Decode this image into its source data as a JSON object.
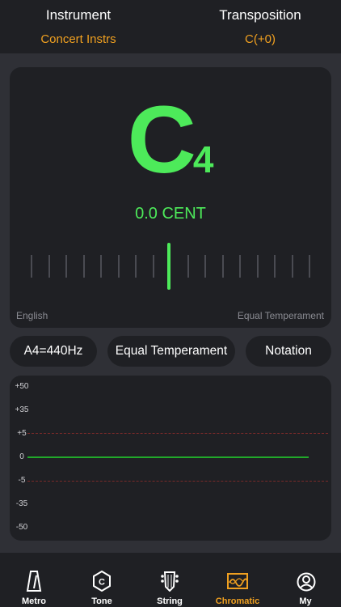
{
  "header": {
    "instrument_label": "Instrument",
    "instrument_value": "Concert Instrs",
    "transposition_label": "Transposition",
    "transposition_value": "C(+0)"
  },
  "tuner": {
    "note": "C",
    "octave": "4",
    "cents_text": "0.0 CENT",
    "cents_value": 0.0,
    "notation_language": "English",
    "temperament_label": "Equal Temperament"
  },
  "controls": {
    "a4_label": "A4=440Hz",
    "temperament_label": "Equal Temperament",
    "notation_label": "Notation"
  },
  "history": {
    "y_ticks": [
      "+50",
      "+35",
      "+5",
      "0",
      "-5",
      "-35",
      "-50"
    ],
    "current_value": 0
  },
  "tabs": [
    {
      "label": "Metro",
      "icon": "metronome-icon",
      "active": false
    },
    {
      "label": "Tone",
      "icon": "tone-icon",
      "active": false
    },
    {
      "label": "String",
      "icon": "guitar-headstock-icon",
      "active": false
    },
    {
      "label": "Chromatic",
      "icon": "chromatic-wave-icon",
      "active": true
    },
    {
      "label": "My",
      "icon": "profile-icon",
      "active": false
    }
  ],
  "colors": {
    "accent": "#f0a020",
    "in_tune": "#4dea5a",
    "panel": "#1f2024",
    "background": "#2f3036"
  }
}
